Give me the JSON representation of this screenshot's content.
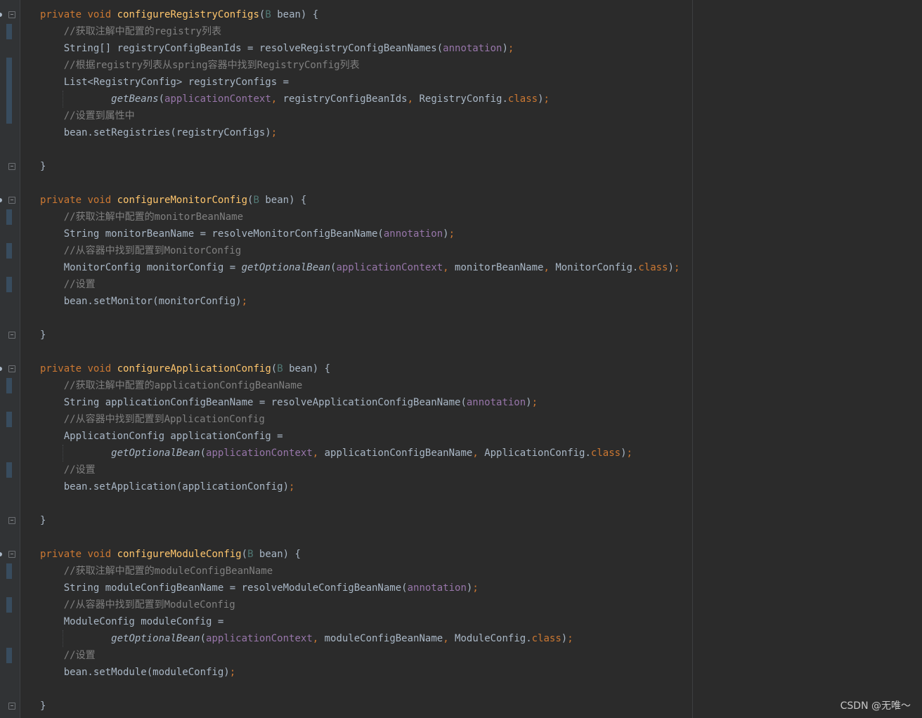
{
  "colors": {
    "background": "#2b2b2b",
    "gutter": "#313335",
    "keyword": "#cc7832",
    "function": "#ffc66d",
    "comment": "#808080",
    "field": "#9876aa",
    "text": "#a9b7c6"
  },
  "editor": {
    "lines": [
      [
        {
          "t": "private",
          "c": "kw"
        },
        {
          "t": " "
        },
        {
          "t": "void",
          "c": "kw"
        },
        {
          "t": " "
        },
        {
          "t": "configureRegistryConfigs",
          "c": "fn"
        },
        {
          "t": "("
        },
        {
          "t": "B",
          "c": "ty"
        },
        {
          "t": " bean) {"
        }
      ],
      [
        {
          "t": "    "
        },
        {
          "t": "//获取注解中配置的registry列表",
          "c": "cm"
        }
      ],
      [
        {
          "t": "    String[] registryConfigBeanIds = resolveRegistryConfigBeanNames("
        },
        {
          "t": "annotation",
          "c": "pm"
        },
        {
          "t": ")"
        },
        {
          "t": ";",
          "c": "kw"
        }
      ],
      [
        {
          "t": "    "
        },
        {
          "t": "//根据registry列表从spring容器中找到RegistryConfig列表",
          "c": "cm"
        }
      ],
      [
        {
          "t": "    List<RegistryConfig> registryConfigs ="
        }
      ],
      [
        {
          "t": "            "
        },
        {
          "t": "getBeans",
          "c": "it"
        },
        {
          "t": "("
        },
        {
          "t": "applicationContext",
          "c": "pm"
        },
        {
          "t": ", ",
          "c": "kw"
        },
        {
          "t": "registryConfigBeanIds"
        },
        {
          "t": ", ",
          "c": "kw"
        },
        {
          "t": "RegistryConfig."
        },
        {
          "t": "class",
          "c": "kw"
        },
        {
          "t": ")"
        },
        {
          "t": ";",
          "c": "kw"
        }
      ],
      [
        {
          "t": "    "
        },
        {
          "t": "//设置到属性中",
          "c": "cm"
        }
      ],
      [
        {
          "t": "    bean.setRegistries(registryConfigs)"
        },
        {
          "t": ";",
          "c": "kw"
        }
      ],
      [],
      [
        {
          "t": "}"
        }
      ],
      [],
      [
        {
          "t": "private",
          "c": "kw"
        },
        {
          "t": " "
        },
        {
          "t": "void",
          "c": "kw"
        },
        {
          "t": " "
        },
        {
          "t": "configureMonitorConfig",
          "c": "fn"
        },
        {
          "t": "("
        },
        {
          "t": "B",
          "c": "ty"
        },
        {
          "t": " bean) {"
        }
      ],
      [
        {
          "t": "    "
        },
        {
          "t": "//获取注解中配置的monitorBeanName",
          "c": "cm"
        }
      ],
      [
        {
          "t": "    String monitorBeanName = resolveMonitorConfigBeanName("
        },
        {
          "t": "annotation",
          "c": "pm"
        },
        {
          "t": ")"
        },
        {
          "t": ";",
          "c": "kw"
        }
      ],
      [
        {
          "t": "    "
        },
        {
          "t": "//从容器中找到配置到MonitorConfig",
          "c": "cm"
        }
      ],
      [
        {
          "t": "    MonitorConfig monitorConfig = "
        },
        {
          "t": "getOptionalBean",
          "c": "it"
        },
        {
          "t": "("
        },
        {
          "t": "applicationContext",
          "c": "pm"
        },
        {
          "t": ", ",
          "c": "kw"
        },
        {
          "t": "monitorBeanName"
        },
        {
          "t": ", ",
          "c": "kw"
        },
        {
          "t": "MonitorConfig."
        },
        {
          "t": "class",
          "c": "kw"
        },
        {
          "t": ")"
        },
        {
          "t": ";",
          "c": "kw"
        }
      ],
      [
        {
          "t": "    "
        },
        {
          "t": "//设置",
          "c": "cm"
        }
      ],
      [
        {
          "t": "    bean.setMonitor(monitorConfig)"
        },
        {
          "t": ";",
          "c": "kw"
        }
      ],
      [],
      [
        {
          "t": "}"
        }
      ],
      [],
      [
        {
          "t": "private",
          "c": "kw"
        },
        {
          "t": " "
        },
        {
          "t": "void",
          "c": "kw"
        },
        {
          "t": " "
        },
        {
          "t": "configureApplicationConfig",
          "c": "fn"
        },
        {
          "t": "("
        },
        {
          "t": "B",
          "c": "ty"
        },
        {
          "t": " bean) {"
        }
      ],
      [
        {
          "t": "    "
        },
        {
          "t": "//获取注解中配置的applicationConfigBeanName",
          "c": "cm"
        }
      ],
      [
        {
          "t": "    String applicationConfigBeanName = resolveApplicationConfigBeanName("
        },
        {
          "t": "annotation",
          "c": "pm"
        },
        {
          "t": ")"
        },
        {
          "t": ";",
          "c": "kw"
        }
      ],
      [
        {
          "t": "    "
        },
        {
          "t": "//从容器中找到配置到ApplicationConfig",
          "c": "cm"
        }
      ],
      [
        {
          "t": "    ApplicationConfig applicationConfig ="
        }
      ],
      [
        {
          "t": "            "
        },
        {
          "t": "getOptionalBean",
          "c": "it"
        },
        {
          "t": "("
        },
        {
          "t": "applicationContext",
          "c": "pm"
        },
        {
          "t": ", ",
          "c": "kw"
        },
        {
          "t": "applicationConfigBeanName"
        },
        {
          "t": ", ",
          "c": "kw"
        },
        {
          "t": "ApplicationConfig."
        },
        {
          "t": "class",
          "c": "kw"
        },
        {
          "t": ")"
        },
        {
          "t": ";",
          "c": "kw"
        }
      ],
      [
        {
          "t": "    "
        },
        {
          "t": "//设置",
          "c": "cm"
        }
      ],
      [
        {
          "t": "    bean.setApplication(applicationConfig)"
        },
        {
          "t": ";",
          "c": "kw"
        }
      ],
      [],
      [
        {
          "t": "}"
        }
      ],
      [],
      [
        {
          "t": "private",
          "c": "kw"
        },
        {
          "t": " "
        },
        {
          "t": "void",
          "c": "kw"
        },
        {
          "t": " "
        },
        {
          "t": "configureModuleConfig",
          "c": "fn"
        },
        {
          "t": "("
        },
        {
          "t": "B",
          "c": "ty"
        },
        {
          "t": " bean) {"
        }
      ],
      [
        {
          "t": "    "
        },
        {
          "t": "//获取注解中配置的moduleConfigBeanName",
          "c": "cm"
        }
      ],
      [
        {
          "t": "    String moduleConfigBeanName = resolveModuleConfigBeanName("
        },
        {
          "t": "annotation",
          "c": "pm"
        },
        {
          "t": ")"
        },
        {
          "t": ";",
          "c": "kw"
        }
      ],
      [
        {
          "t": "    "
        },
        {
          "t": "//从容器中找到配置到ModuleConfig",
          "c": "cm"
        }
      ],
      [
        {
          "t": "    ModuleConfig moduleConfig ="
        }
      ],
      [
        {
          "t": "            "
        },
        {
          "t": "getOptionalBean",
          "c": "it"
        },
        {
          "t": "("
        },
        {
          "t": "applicationContext",
          "c": "pm"
        },
        {
          "t": ", ",
          "c": "kw"
        },
        {
          "t": "moduleConfigBeanName"
        },
        {
          "t": ", ",
          "c": "kw"
        },
        {
          "t": "ModuleConfig."
        },
        {
          "t": "class",
          "c": "kw"
        },
        {
          "t": ")"
        },
        {
          "t": ";",
          "c": "kw"
        }
      ],
      [
        {
          "t": "    "
        },
        {
          "t": "//设置",
          "c": "cm"
        }
      ],
      [
        {
          "t": "    bean.setModule(moduleConfig)"
        },
        {
          "t": ";",
          "c": "kw"
        }
      ],
      [],
      [
        {
          "t": "}"
        }
      ]
    ]
  },
  "watermark": {
    "text": "CSDN @无唯～"
  }
}
